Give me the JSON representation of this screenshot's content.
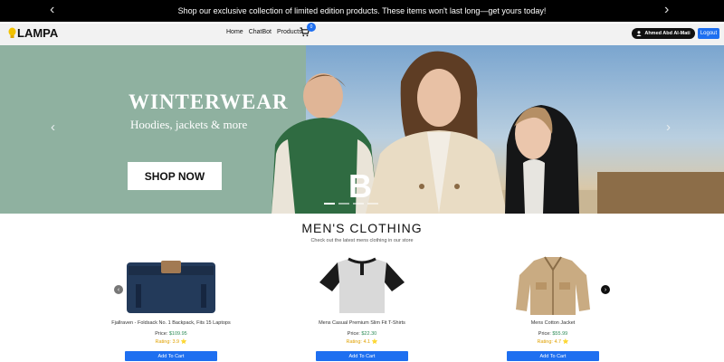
{
  "promo": {
    "text": "Shop our exclusive collection of limited edition products. These items won't last long—get yours today!"
  },
  "nav": {
    "logo": "LAMPA",
    "links": [
      "Home",
      "ChatBot",
      "Products"
    ],
    "cart_count": "0",
    "user_name": "Ahmed Abd Al-Mati",
    "logout_label": "Logout"
  },
  "hero": {
    "title": "WINTERWEAR",
    "subtitle": "Hoodies, jackets & more",
    "cta_label": "SHOP NOW",
    "slides": 4,
    "active_slide": 1
  },
  "section": {
    "title": "MEN'S CLOTHING",
    "subtitle": "Check out the latest mens clothing in our store"
  },
  "products": [
    {
      "name": "Fjallraven - Foldsack No. 1 Backpack, Fits 15 Laptops",
      "price_label": "Price: ",
      "price": "$109.95",
      "rating_label": "Rating: 3.9",
      "button_label": "Add To Cart"
    },
    {
      "name": "Mens Casual Premium Slim Fit T-Shirts",
      "price_label": "Price: ",
      "price": "$22.30",
      "rating_label": "Rating: 4.1",
      "button_label": "Add To Cart"
    },
    {
      "name": "Mens Cotton Jacket",
      "price_label": "Price: ",
      "price": "$55.99",
      "rating_label": "Rating: 4.7",
      "button_label": "Add To Cart"
    }
  ],
  "colors": {
    "accent": "#1e6ff0",
    "dark": "#111111",
    "rating": "#e0a100",
    "price": "#2e8b57"
  }
}
